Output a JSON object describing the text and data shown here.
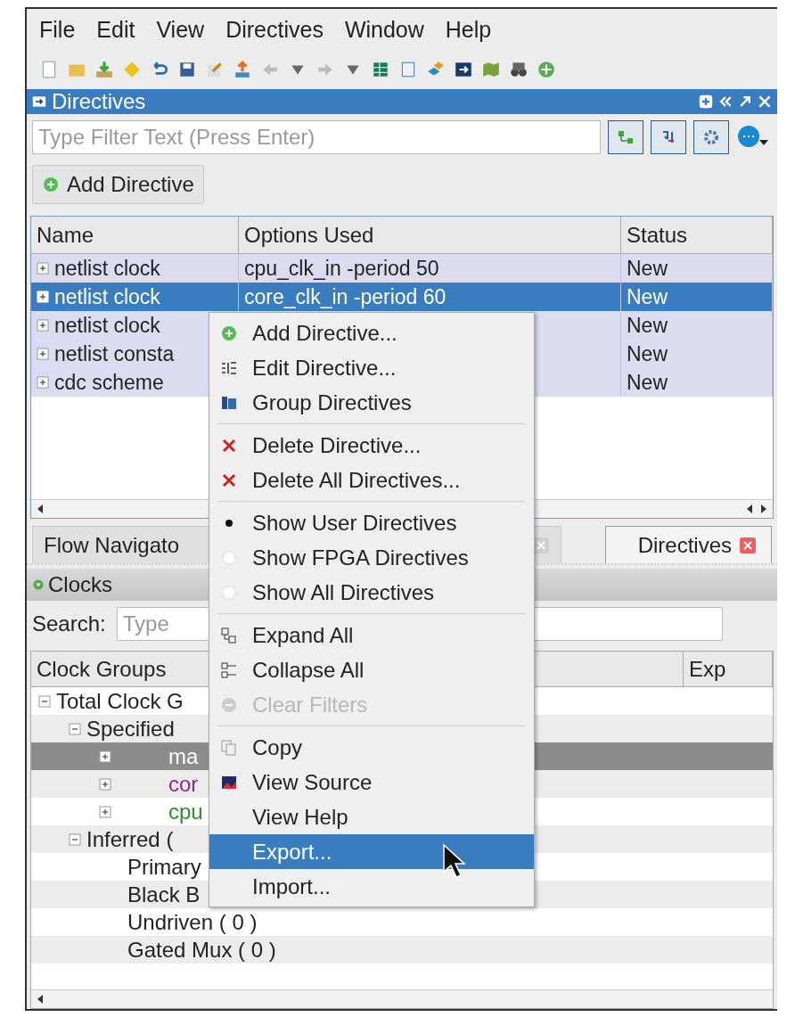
{
  "menu_bar": [
    "File",
    "Edit",
    "View",
    "Directives",
    "Window",
    "Help"
  ],
  "directives_panel": {
    "title": "Directives",
    "filter": {
      "placeholder": "Type Filter Text (Press Enter)"
    },
    "add_button": "Add Directive",
    "table": {
      "columns": [
        "Name",
        "Options Used",
        "Status"
      ],
      "rows": [
        {
          "name": "netlist clock",
          "options": "cpu_clk_in -period 50",
          "status": "New",
          "selected": false
        },
        {
          "name": "netlist clock",
          "options": "core_clk_in -period 60",
          "status": "New",
          "selected": true
        },
        {
          "name": "netlist clock",
          "status": "New",
          "selected": false
        },
        {
          "name": "netlist consta",
          "status": "New",
          "selected": false
        },
        {
          "name": "cdc scheme",
          "status": "New",
          "selected": false
        }
      ]
    }
  },
  "bottom_tabs": [
    {
      "label": "Flow Navigato",
      "selected": false,
      "closable": false
    },
    {
      "selected": false,
      "closable": true
    },
    {
      "label": "Directives",
      "selected": true,
      "closable": true
    }
  ],
  "clocks_panel": {
    "title": "Clocks",
    "search_label": "Search:",
    "search_placeholder": "Type",
    "columns": [
      "Clock Groups",
      "Exp"
    ],
    "tree": [
      {
        "label": "Total Clock G",
        "expanded": true,
        "selected": false,
        "children": [
          {
            "label": "Specified",
            "expanded": true,
            "selected": false,
            "children": [
              {
                "label": "ma",
                "expanded": false,
                "selected": true
              },
              {
                "label": "cor",
                "expanded": false,
                "selected": false,
                "color": "#8b2a8b"
              },
              {
                "label": "cpu",
                "expanded": false,
                "selected": false,
                "color": "#2f8f2f"
              }
            ]
          },
          {
            "label": "Inferred (",
            "expanded": true,
            "selected": false,
            "children": [
              {
                "label": "Primary",
                "selected": false
              },
              {
                "label": "Black B",
                "selected": false
              },
              {
                "label": "Undriven ( 0 )",
                "selected": false
              },
              {
                "label": "Gated Mux ( 0 )",
                "selected": false
              }
            ]
          }
        ]
      }
    ]
  },
  "context_menu": {
    "items": [
      {
        "kind": "action",
        "label": "Add Directive...",
        "disabled": false,
        "selected": false
      },
      {
        "kind": "action",
        "label": "Edit Directive...",
        "disabled": false,
        "selected": false
      },
      {
        "kind": "action",
        "label": "Group Directives",
        "disabled": false,
        "selected": false
      },
      {
        "kind": "separator"
      },
      {
        "kind": "action",
        "label": "Delete Directive...",
        "disabled": false,
        "selected": false
      },
      {
        "kind": "action",
        "label": "Delete All Directives...",
        "disabled": false,
        "selected": false
      },
      {
        "kind": "separator"
      },
      {
        "kind": "radio",
        "label": "Show User Directives",
        "checked": true
      },
      {
        "kind": "radio",
        "label": "Show FPGA Directives",
        "checked": false
      },
      {
        "kind": "radio",
        "label": "Show All Directives",
        "checked": false
      },
      {
        "kind": "separator"
      },
      {
        "kind": "action",
        "label": "Expand All",
        "disabled": false,
        "selected": false
      },
      {
        "kind": "action",
        "label": "Collapse All",
        "disabled": false,
        "selected": false
      },
      {
        "kind": "action",
        "label": "Clear Filters",
        "disabled": true,
        "selected": false
      },
      {
        "kind": "separator"
      },
      {
        "kind": "action",
        "label": "Copy",
        "disabled": false,
        "selected": false
      },
      {
        "kind": "action",
        "label": "View Source",
        "disabled": false,
        "selected": false
      },
      {
        "kind": "action",
        "label": "View Help",
        "disabled": false,
        "selected": false
      },
      {
        "kind": "action",
        "label": "Export...",
        "disabled": false,
        "selected": true
      },
      {
        "kind": "action",
        "label": "Import...",
        "disabled": false,
        "selected": false
      }
    ]
  }
}
